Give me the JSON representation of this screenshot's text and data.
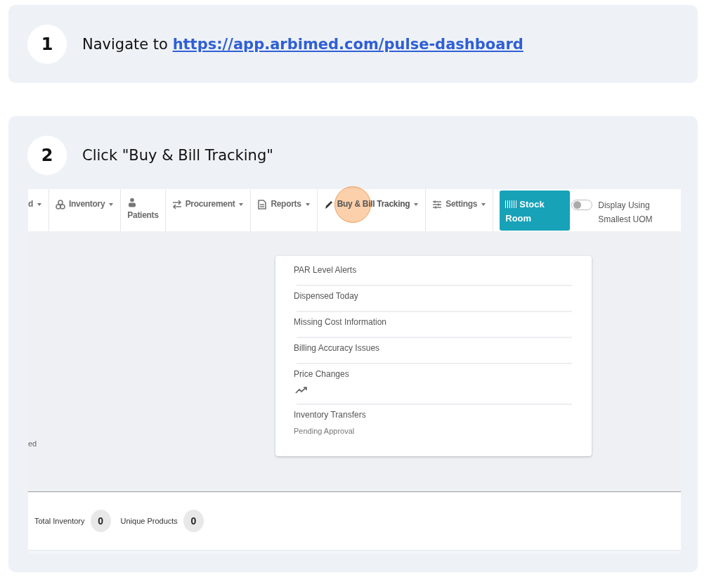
{
  "steps": [
    {
      "number": "1",
      "kind": "navigate",
      "text": "Navigate to ",
      "link": "https://app.arbimed.com/pulse-dashboard"
    },
    {
      "number": "2",
      "kind": "click",
      "text": "Click \"Buy & Bill Tracking\"",
      "screenshot": {
        "nav": [
          {
            "label": "d",
            "dropdown": true,
            "highlighted": false
          },
          {
            "label": "Inventory",
            "dropdown": true,
            "highlighted": false
          },
          {
            "label": "Patients",
            "dropdown": false,
            "highlighted": false
          },
          {
            "label": "Procurement",
            "dropdown": true,
            "highlighted": false
          },
          {
            "label": "Reports",
            "dropdown": true,
            "highlighted": false
          },
          {
            "label": "Buy & Bill Tracking",
            "dropdown": true,
            "highlighted": true
          },
          {
            "label": "Settings",
            "dropdown": true,
            "highlighted": false
          }
        ],
        "stock_room_button": "Stock Room",
        "toggle": {
          "label": "Display Using Smallest UOM",
          "on": false
        },
        "side_fragment": "ed",
        "dropdown_items": [
          {
            "kind": "plain",
            "label": "PAR Level Alerts"
          },
          {
            "kind": "plain",
            "label": "Dispensed Today"
          },
          {
            "kind": "plain",
            "label": "Missing Cost Information"
          },
          {
            "kind": "plain",
            "label": "Billing Accuracy Issues"
          },
          {
            "kind": "trend",
            "label": "Price Changes"
          },
          {
            "kind": "subtitle",
            "label": "Inventory Transfers",
            "subtitle": "Pending Approval"
          }
        ],
        "stats": [
          {
            "label": "Total Inventory",
            "value": "0"
          },
          {
            "label": "Unique Products",
            "value": "0"
          }
        ]
      }
    }
  ]
}
